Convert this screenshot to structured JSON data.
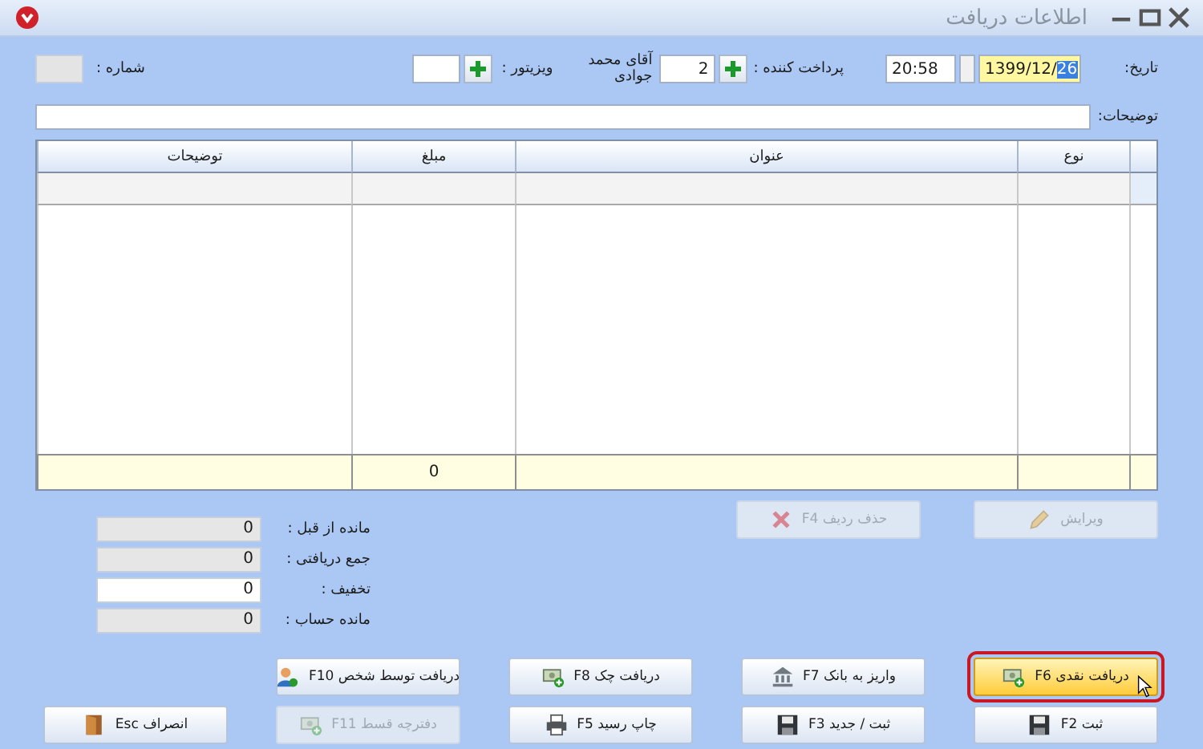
{
  "window": {
    "title": "اطلاعات دریافت"
  },
  "header": {
    "date_label": "تاریخ:",
    "date": "1399/12/",
    "date_selected": "26",
    "time": "20:58",
    "payer_label": "پرداخت کننده :",
    "payer_code": "2",
    "payer_name": "آقای محمد جوادی",
    "visitor_label": "ویزیتور :",
    "number_label": "شماره :"
  },
  "description": {
    "label": "توضیحات:"
  },
  "table": {
    "columns": [
      "نوع",
      "عنوان",
      "مبلغ",
      "توضیحات"
    ],
    "amount_total": "0"
  },
  "row_actions": [
    {
      "label": "ویرایش",
      "kind": "pencil",
      "disabled": true
    },
    {
      "label": "حذف ردیف F4",
      "kind": "cross",
      "disabled": true
    }
  ],
  "summary": [
    {
      "label": "مانده از قبل :",
      "value": "0",
      "editable": false
    },
    {
      "label": "جمع دریافتی :",
      "value": "0",
      "editable": false
    },
    {
      "label": "تخفیف :",
      "value": "0",
      "editable": true
    },
    {
      "label": "مانده حساب :",
      "value": "0",
      "editable": false
    }
  ],
  "button_rows": [
    [
      {
        "label": "دریافت نقدی F6",
        "kind": "cash",
        "disabled": false,
        "focused": true
      },
      {
        "label": "واریز به بانک F7",
        "kind": "bank",
        "disabled": false,
        "focused": false
      },
      {
        "label": "دریافت چک F8",
        "kind": "cash",
        "disabled": false,
        "focused": false
      },
      {
        "label": "دریافت توسط شخص F10",
        "kind": "person",
        "disabled": false,
        "focused": false
      }
    ],
    [
      {
        "label": "ثبت F2",
        "kind": "save",
        "disabled": false,
        "focused": false
      },
      {
        "label": "ثبت / جدید F3",
        "kind": "save-new",
        "disabled": false,
        "focused": false
      },
      {
        "label": "چاپ رسید F5",
        "kind": "print",
        "disabled": false,
        "focused": false
      },
      {
        "label": "دفترچه قسط F11",
        "kind": "cash",
        "disabled": true,
        "focused": false
      },
      {
        "label": "انصراف Esc",
        "kind": "door",
        "disabled": false,
        "focused": false
      }
    ]
  ]
}
